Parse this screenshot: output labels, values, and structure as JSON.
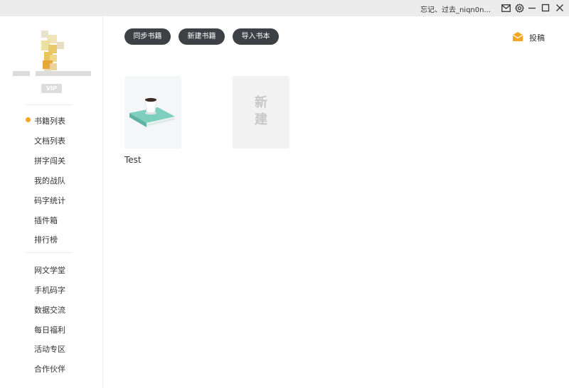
{
  "titlebar": {
    "user_label": "忘记、过去_niqn0n...",
    "icons": [
      "mail-icon",
      "gear-icon",
      "minimize-icon",
      "maximize-icon",
      "close-icon"
    ]
  },
  "sidebar": {
    "vip_label": "VIP",
    "nav_primary": [
      {
        "label": "书籍列表",
        "active": true
      },
      {
        "label": "文档列表"
      },
      {
        "label": "拼字闯关"
      },
      {
        "label": "我的战队"
      },
      {
        "label": "码字统计"
      },
      {
        "label": "插件箱"
      },
      {
        "label": "排行榜"
      }
    ],
    "nav_secondary": [
      {
        "label": "网文学堂"
      },
      {
        "label": "手机码字"
      },
      {
        "label": "数据交流"
      },
      {
        "label": "每日福利"
      },
      {
        "label": "活动专区"
      },
      {
        "label": "合作伙伴"
      }
    ]
  },
  "toolbar": {
    "sync_label": "同步书籍",
    "new_book_label": "新建书籍",
    "import_label": "导入书本",
    "submit_label": "投稿"
  },
  "books": [
    {
      "title": "Test"
    }
  ],
  "new_card": {
    "line1": "新",
    "line2": "建"
  },
  "colors": {
    "accent": "#f5a623",
    "button_bg": "#3d4145",
    "book_cover": "#7fcfbf"
  }
}
